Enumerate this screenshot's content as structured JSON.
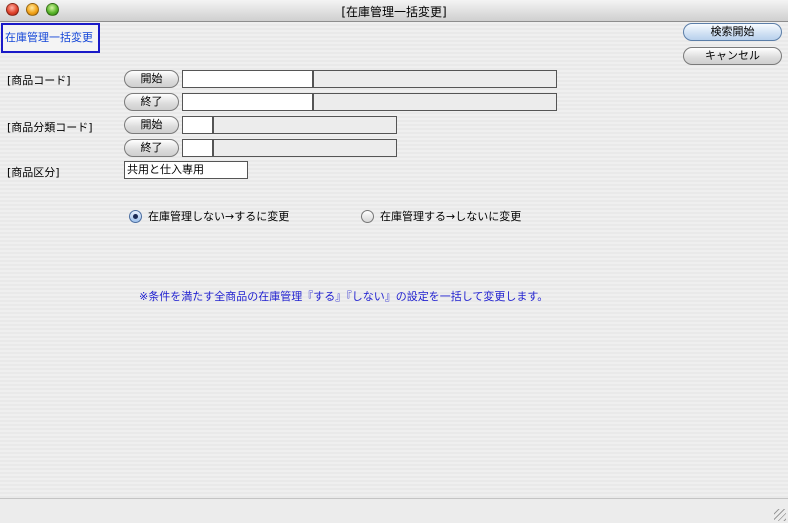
{
  "window": {
    "title": "[在庫管理一括変更]"
  },
  "screen_title": "在庫管理一括変更",
  "buttons": {
    "search_start": "検索開始",
    "cancel": "キャンセル",
    "start": "開始",
    "end": "終了"
  },
  "fields": {
    "product_code": {
      "label": "[商品コード]",
      "start_code": "",
      "start_name": "",
      "end_code": "",
      "end_name": ""
    },
    "category_code": {
      "label": "[商品分類コード]",
      "start_code": "",
      "start_name": "",
      "end_code": "",
      "end_name": ""
    },
    "product_type": {
      "label": "[商品区分]",
      "value": "共用と仕入専用"
    }
  },
  "radios": {
    "option1": {
      "label": "在庫管理しない→するに変更",
      "selected": true
    },
    "option2": {
      "label": "在庫管理する→しないに変更",
      "selected": false
    }
  },
  "note": "※条件を満たす全商品の在庫管理『する』『しない』の設定を一括して変更します。"
}
